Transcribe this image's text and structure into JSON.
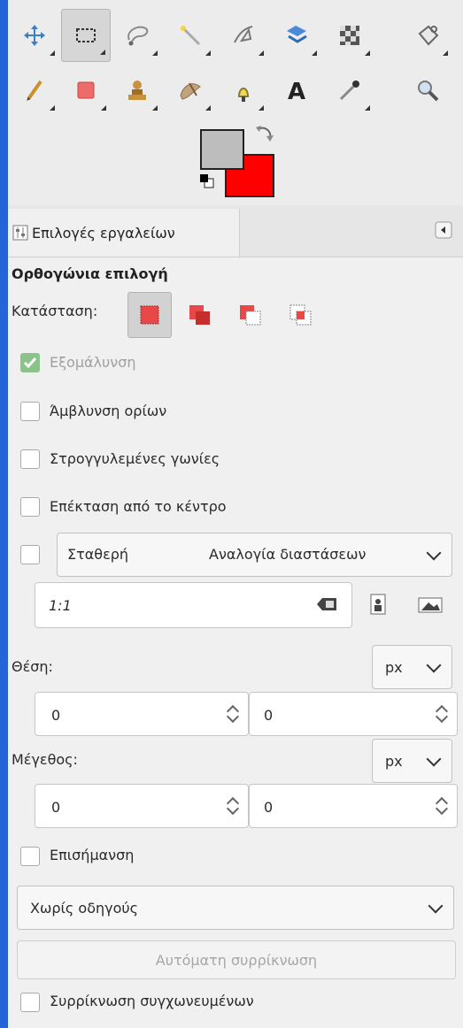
{
  "tab": {
    "label": "Επιλογές εργαλείων"
  },
  "tool_options": {
    "title": "Ορθογώνια επιλογή",
    "mode_label": "Κατάσταση:",
    "antialias_label": "Εξομάλυνση",
    "feather_label": "Άμβλυνση ορίων",
    "rounded_label": "Στρογγυλεμένες γωνίες",
    "expand_label": "Επέκταση από το κέντρο",
    "fixed": {
      "label": "Σταθερή",
      "mode": "Αναλογία διαστάσεων",
      "value": "1:1"
    },
    "position": {
      "label": "Θέση:",
      "unit": "px",
      "x": "0",
      "y": "0"
    },
    "size": {
      "label": "Μέγεθος:",
      "unit": "px",
      "w": "0",
      "h": "0"
    },
    "highlight_label": "Επισήμανση",
    "guides": "Χωρίς οδηγούς",
    "autoshrink_label": "Αυτόματη συρρίκνωση",
    "shrink_merged_label": "Συρρίκνωση συγχωνευμένων"
  },
  "colors": {
    "foreground": "#bdbdbd",
    "background": "#ff0000",
    "frame": "#2563d6"
  },
  "tools": [
    {
      "icon": "move-tool-icon"
    },
    {
      "icon": "rect-select-tool-icon"
    },
    {
      "icon": "free-select-tool-icon"
    },
    {
      "icon": "fuzzy-select-tool-icon"
    },
    {
      "icon": "paths-tool-icon"
    },
    {
      "icon": "unified-transform-tool-icon"
    },
    {
      "icon": "warp-transform-tool-icon"
    },
    {
      "icon": "bucket-fill-tool-icon"
    },
    {
      "icon": "pencil-tool-icon"
    },
    {
      "icon": "eraser-tool-icon"
    },
    {
      "icon": "clone-tool-icon"
    },
    {
      "icon": "smudge-tool-icon"
    },
    {
      "icon": "dodge-burn-tool-icon"
    },
    {
      "icon": "text-tool-icon"
    },
    {
      "icon": "color-picker-tool-icon"
    },
    {
      "icon": "zoom-tool-icon"
    }
  ]
}
